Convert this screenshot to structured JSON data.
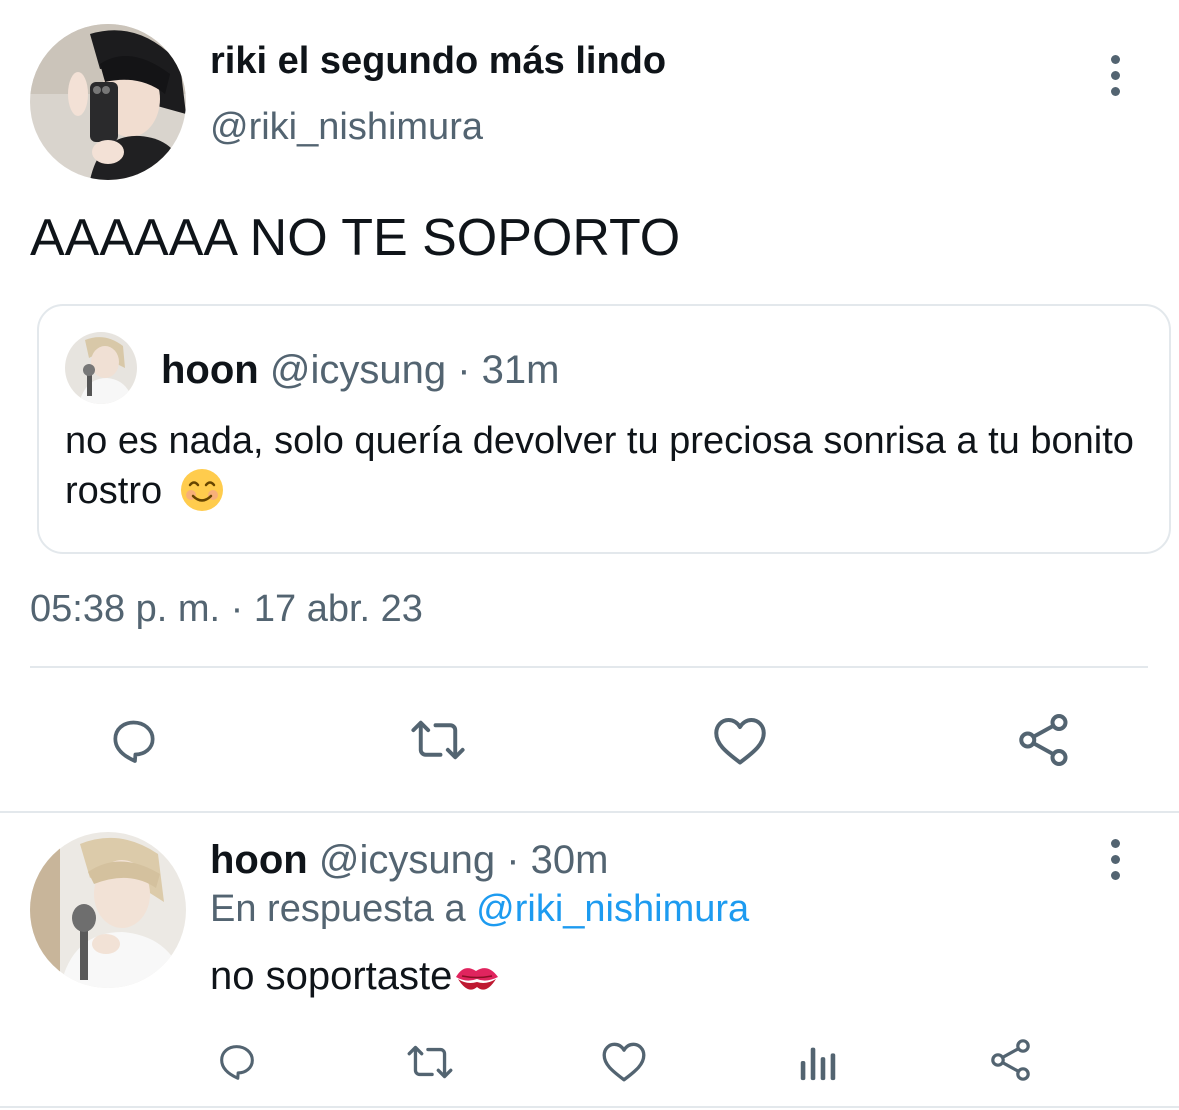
{
  "main_tweet": {
    "display_name": "riki el segundo más lindo",
    "handle": "@riki_nishimura",
    "text": "AAAAAA NO TE SOPORTO",
    "timestamp": "05:38 p. m. · 17 abr. 23",
    "more_icon": "more-vertical-icon",
    "actions": [
      "reply-icon",
      "retweet-icon",
      "like-icon",
      "share-icon"
    ]
  },
  "quoted_tweet": {
    "name": "hoon",
    "meta": "@icysung · 31m",
    "text": "no es nada, solo quería devolver tu preciosa sonrisa a tu bonito rostro",
    "emoji": "smiling-face-emoji"
  },
  "reply": {
    "name": "hoon",
    "meta": "@icysung · 30m",
    "replying_prefix": "En respuesta a",
    "replying_to": "@riki_nishimura",
    "text": "no soportaste",
    "emoji": "kiss-mark-emoji",
    "more_icon": "more-vertical-icon",
    "actions": [
      "reply-icon",
      "retweet-icon",
      "like-icon",
      "views-icon",
      "share-icon"
    ]
  },
  "colors": {
    "text_primary": "#0f1419",
    "text_secondary": "#536471",
    "link": "#1d9bf0",
    "border": "#e3e8ec"
  }
}
